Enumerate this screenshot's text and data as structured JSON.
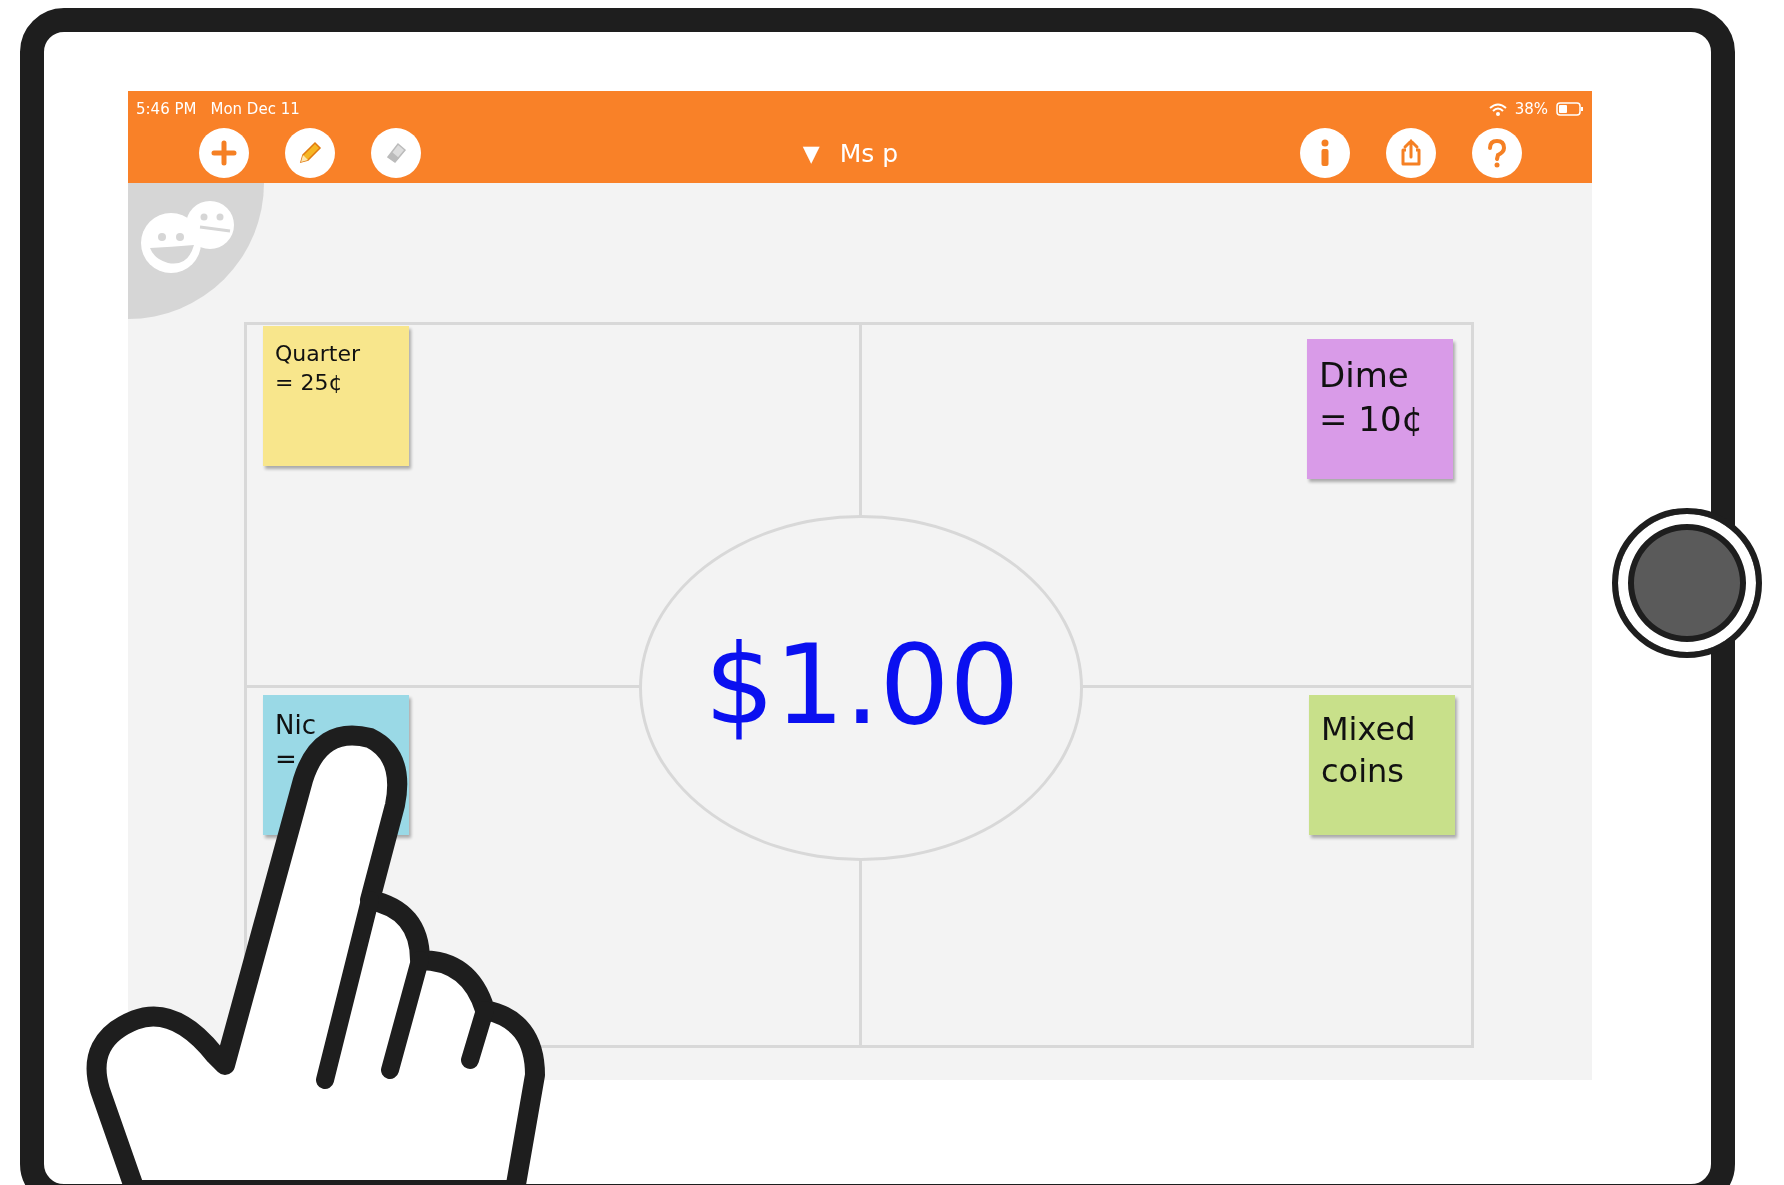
{
  "status_bar": {
    "time": "5:46 PM",
    "date": "Mon Dec 11",
    "battery": "38%"
  },
  "toolbar": {
    "left_buttons": [
      {
        "kind": "add"
      },
      {
        "kind": "pen"
      },
      {
        "kind": "eraser"
      }
    ],
    "title_caret": "▼",
    "title": "Ms p",
    "right_buttons": [
      {
        "kind": "info"
      },
      {
        "kind": "share"
      },
      {
        "kind": "help"
      }
    ]
  },
  "board": {
    "center_text": "$1.00",
    "notes": [
      {
        "lines": [
          "Quarter",
          "= 25¢"
        ],
        "color": "#f8e68c"
      },
      {
        "lines": [
          "Dime",
          "= 10¢"
        ],
        "color": "#d99be8"
      },
      {
        "lines": [
          "Nic",
          "="
        ],
        "color": "#9ad9e6"
      },
      {
        "lines": [
          "Mixed",
          "coins"
        ],
        "color": "#c8e08a"
      }
    ]
  }
}
